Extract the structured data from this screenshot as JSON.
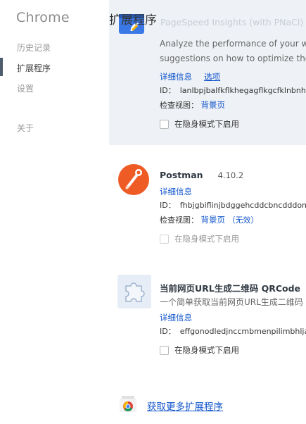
{
  "sidebar": {
    "brand": "Chrome",
    "items": [
      {
        "label": "历史记录"
      },
      {
        "label": "扩展程序"
      },
      {
        "label": "设置"
      },
      {
        "label": "关于"
      }
    ]
  },
  "header": {
    "title": "扩展程序"
  },
  "extensions": [
    {
      "name": "PageSpeed Insights (with PNaCl)",
      "desc_line1": "Analyze the performance of your we",
      "desc_line2": "suggestions on how to optimize ther",
      "details_label": "详细信息",
      "options_label": "选项",
      "id_label": "ID：",
      "id_value": "lanlbpjbalfkflkhegagflkgcfklnbnh",
      "inspect_label": "检查视图：",
      "inspect_link": "背景页",
      "incognito_label": "在隐身模式下启用"
    },
    {
      "name": "Postman",
      "version": "4.10.2",
      "details_label": "详细信息",
      "id_label": "ID：",
      "id_value": "fhbjgbiflinjbdggehcddcbncdddom",
      "inspect_label": "检查视图：",
      "inspect_link": "背景页",
      "inspect_suffix": "（无效）",
      "incognito_label": "在隐身模式下启用"
    },
    {
      "name": "当前网页URL生成二维码 QRCode",
      "desc": "一个简单获取当前网页URL生成二维码",
      "details_label": "详细信息",
      "id_label": "ID：",
      "id_value": "effgonodledjnccmbmenpilimbhljah",
      "incognito_label": "在隐身模式下启用"
    }
  ],
  "footer": {
    "get_more": "获取更多扩展程序"
  },
  "colors": {
    "link": "#1155cc",
    "highlight": "#eef1f5",
    "postman": "#ef5b25"
  }
}
